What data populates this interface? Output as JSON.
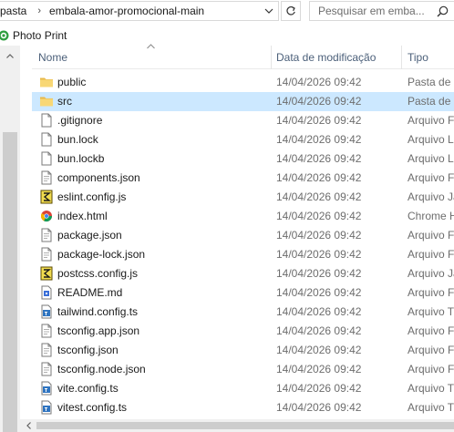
{
  "address_bar": {
    "path": [
      "pasta",
      "embala-amor-promocional-main"
    ],
    "search_placeholder": "Pesquisar em emba..."
  },
  "favorites": {
    "items": [
      {
        "label": "Photo Print",
        "icon": "photo-print-icon"
      }
    ]
  },
  "columns": {
    "name": "Nome",
    "date": "Data de modificação",
    "type": "Tipo",
    "sorted": "name"
  },
  "files": [
    {
      "name": "public",
      "date": "14/04/2026 09:42",
      "type": "Pasta de a",
      "icon": "folder-icon",
      "selected": false
    },
    {
      "name": "src",
      "date": "14/04/2026 09:42",
      "type": "Pasta de a",
      "icon": "folder-icon",
      "selected": true
    },
    {
      "name": ".gitignore",
      "date": "14/04/2026 09:42",
      "type": "Arquivo F",
      "icon": "file-icon",
      "selected": false
    },
    {
      "name": "bun.lock",
      "date": "14/04/2026 09:42",
      "type": "Arquivo L",
      "icon": "file-icon",
      "selected": false
    },
    {
      "name": "bun.lockb",
      "date": "14/04/2026 09:42",
      "type": "Arquivo L",
      "icon": "file-icon",
      "selected": false
    },
    {
      "name": "components.json",
      "date": "14/04/2026 09:42",
      "type": "Arquivo F",
      "icon": "json-file-icon",
      "selected": false
    },
    {
      "name": "eslint.config.js",
      "date": "14/04/2026 09:42",
      "type": "Arquivo Ja",
      "icon": "js-file-icon",
      "selected": false
    },
    {
      "name": "index.html",
      "date": "14/04/2026 09:42",
      "type": "Chrome H",
      "icon": "chrome-html-icon",
      "selected": false
    },
    {
      "name": "package.json",
      "date": "14/04/2026 09:42",
      "type": "Arquivo F",
      "icon": "json-file-icon",
      "selected": false
    },
    {
      "name": "package-lock.json",
      "date": "14/04/2026 09:42",
      "type": "Arquivo F",
      "icon": "json-file-icon",
      "selected": false
    },
    {
      "name": "postcss.config.js",
      "date": "14/04/2026 09:42",
      "type": "Arquivo Ja",
      "icon": "js-file-icon",
      "selected": false
    },
    {
      "name": "README.md",
      "date": "14/04/2026 09:42",
      "type": "Arquivo F",
      "icon": "md-file-icon",
      "selected": false
    },
    {
      "name": "tailwind.config.ts",
      "date": "14/04/2026 09:42",
      "type": "Arquivo T",
      "icon": "ts-file-icon",
      "selected": false
    },
    {
      "name": "tsconfig.app.json",
      "date": "14/04/2026 09:42",
      "type": "Arquivo F",
      "icon": "json-file-icon",
      "selected": false
    },
    {
      "name": "tsconfig.json",
      "date": "14/04/2026 09:42",
      "type": "Arquivo F",
      "icon": "json-file-icon",
      "selected": false
    },
    {
      "name": "tsconfig.node.json",
      "date": "14/04/2026 09:42",
      "type": "Arquivo F",
      "icon": "json-file-icon",
      "selected": false
    },
    {
      "name": "vite.config.ts",
      "date": "14/04/2026 09:42",
      "type": "Arquivo T",
      "icon": "ts-file-icon",
      "selected": false
    },
    {
      "name": "vitest.config.ts",
      "date": "14/04/2026 09:42",
      "type": "Arquivo T",
      "icon": "ts-file-icon",
      "selected": false
    }
  ],
  "colors": {
    "selection": "#cce8ff",
    "header_text": "#4c607a",
    "folder": "#f8d775",
    "js_badge": "#f0db4f",
    "ts_badge": "#2f74c0"
  }
}
